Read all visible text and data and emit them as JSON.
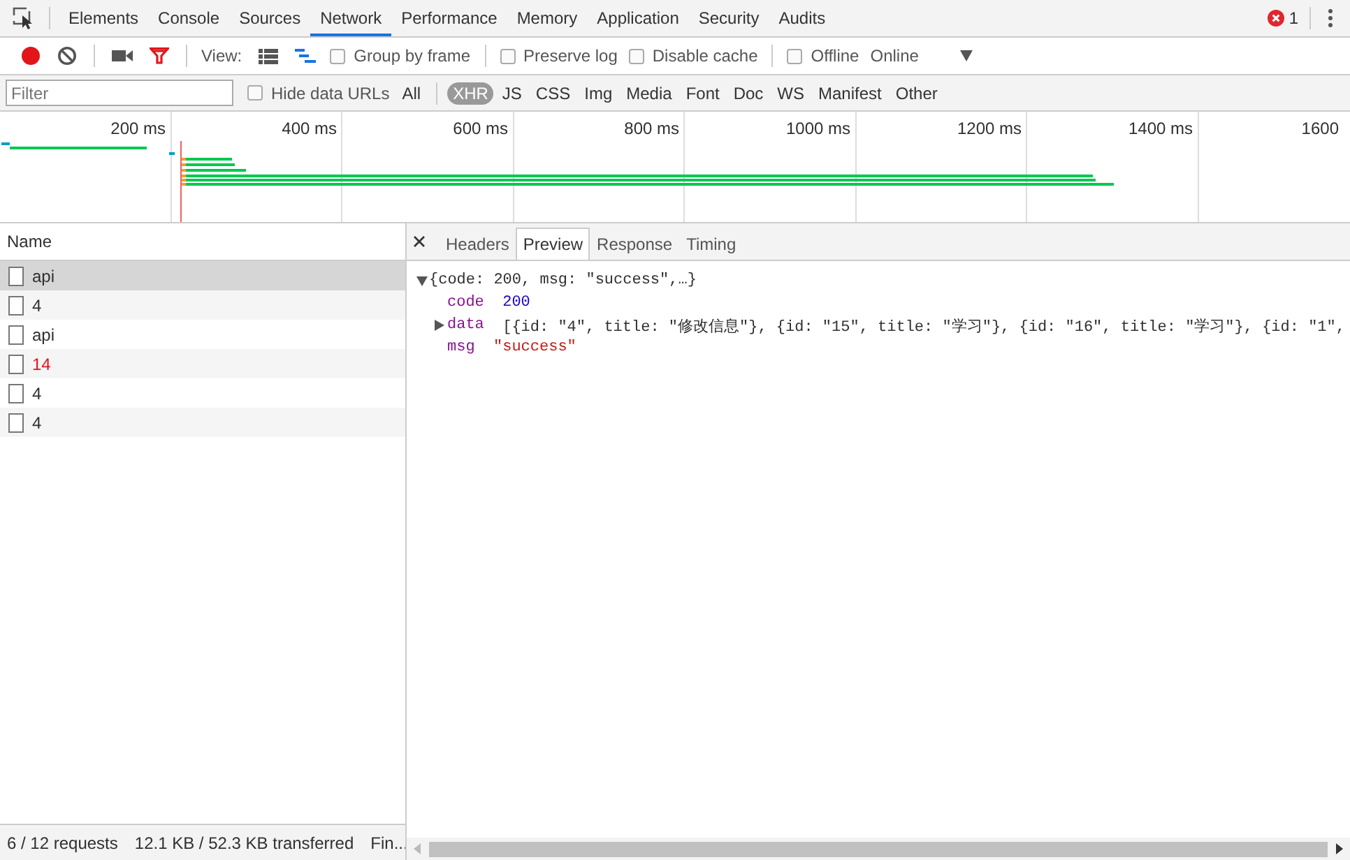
{
  "tabs": [
    {
      "label": "Elements",
      "selected": false
    },
    {
      "label": "Console",
      "selected": false
    },
    {
      "label": "Sources",
      "selected": false
    },
    {
      "label": "Network",
      "selected": true
    },
    {
      "label": "Performance",
      "selected": false
    },
    {
      "label": "Memory",
      "selected": false
    },
    {
      "label": "Application",
      "selected": false
    },
    {
      "label": "Security",
      "selected": false
    },
    {
      "label": "Audits",
      "selected": false
    }
  ],
  "error_count": "1",
  "toolbar": {
    "recording": true,
    "filter_shown": true,
    "view_label": "View:",
    "large_rows": false,
    "overview_on": true,
    "checkboxes": [
      {
        "label": "Group by frame",
        "checked": false
      },
      {
        "label": "Preserve log",
        "checked": false
      },
      {
        "label": "Disable cache",
        "checked": false
      },
      {
        "label": "Offline",
        "checked": false
      }
    ],
    "throttling": "Online"
  },
  "filter_bar": {
    "placeholder": "Filter",
    "hide_data_urls": {
      "label": "Hide data URLs",
      "checked": false
    },
    "types": [
      {
        "label": "All",
        "selected": false
      },
      {
        "label": "XHR",
        "selected": true
      },
      {
        "label": "JS",
        "selected": false
      },
      {
        "label": "CSS",
        "selected": false
      },
      {
        "label": "Img",
        "selected": false
      },
      {
        "label": "Media",
        "selected": false
      },
      {
        "label": "Font",
        "selected": false
      },
      {
        "label": "Doc",
        "selected": false
      },
      {
        "label": "WS",
        "selected": false
      },
      {
        "label": "Manifest",
        "selected": false
      },
      {
        "label": "Other",
        "selected": false
      }
    ]
  },
  "overview": {
    "ticks": [
      "200 ms",
      "400 ms",
      "600 ms",
      "800 ms",
      "1000 ms",
      "1200 ms",
      "1400 ms",
      "1600"
    ]
  },
  "requests": {
    "column": "Name",
    "rows": [
      {
        "name": "api",
        "selected": true,
        "failed": false
      },
      {
        "name": "4",
        "selected": false,
        "failed": false
      },
      {
        "name": "api",
        "selected": false,
        "failed": false
      },
      {
        "name": "14",
        "selected": false,
        "failed": true
      },
      {
        "name": "4",
        "selected": false,
        "failed": false
      },
      {
        "name": "4",
        "selected": false,
        "failed": false
      }
    ]
  },
  "detail": {
    "tabs": [
      {
        "label": "Headers",
        "selected": false
      },
      {
        "label": "Preview",
        "selected": true
      },
      {
        "label": "Response",
        "selected": false
      },
      {
        "label": "Timing",
        "selected": false
      }
    ],
    "preview": {
      "summary": "{code: 200, msg: \"success\",…}",
      "expanded": true,
      "properties": [
        {
          "key": "code",
          "value": "200",
          "kind": "number"
        },
        {
          "key": "data",
          "value": "[{id: \"4\", title: \"修改信息\"}, {id: \"15\", title: \"学习\"}, {id: \"16\", title: \"学习\"}, {id: \"1\",",
          "kind": "array",
          "expanded": false
        },
        {
          "key": "msg",
          "value": "\"success\"",
          "kind": "string"
        }
      ]
    }
  },
  "status_bar": {
    "items": [
      "6 / 12 requests",
      "12.1 KB / 52.3 KB transferred",
      "Fin..."
    ]
  }
}
